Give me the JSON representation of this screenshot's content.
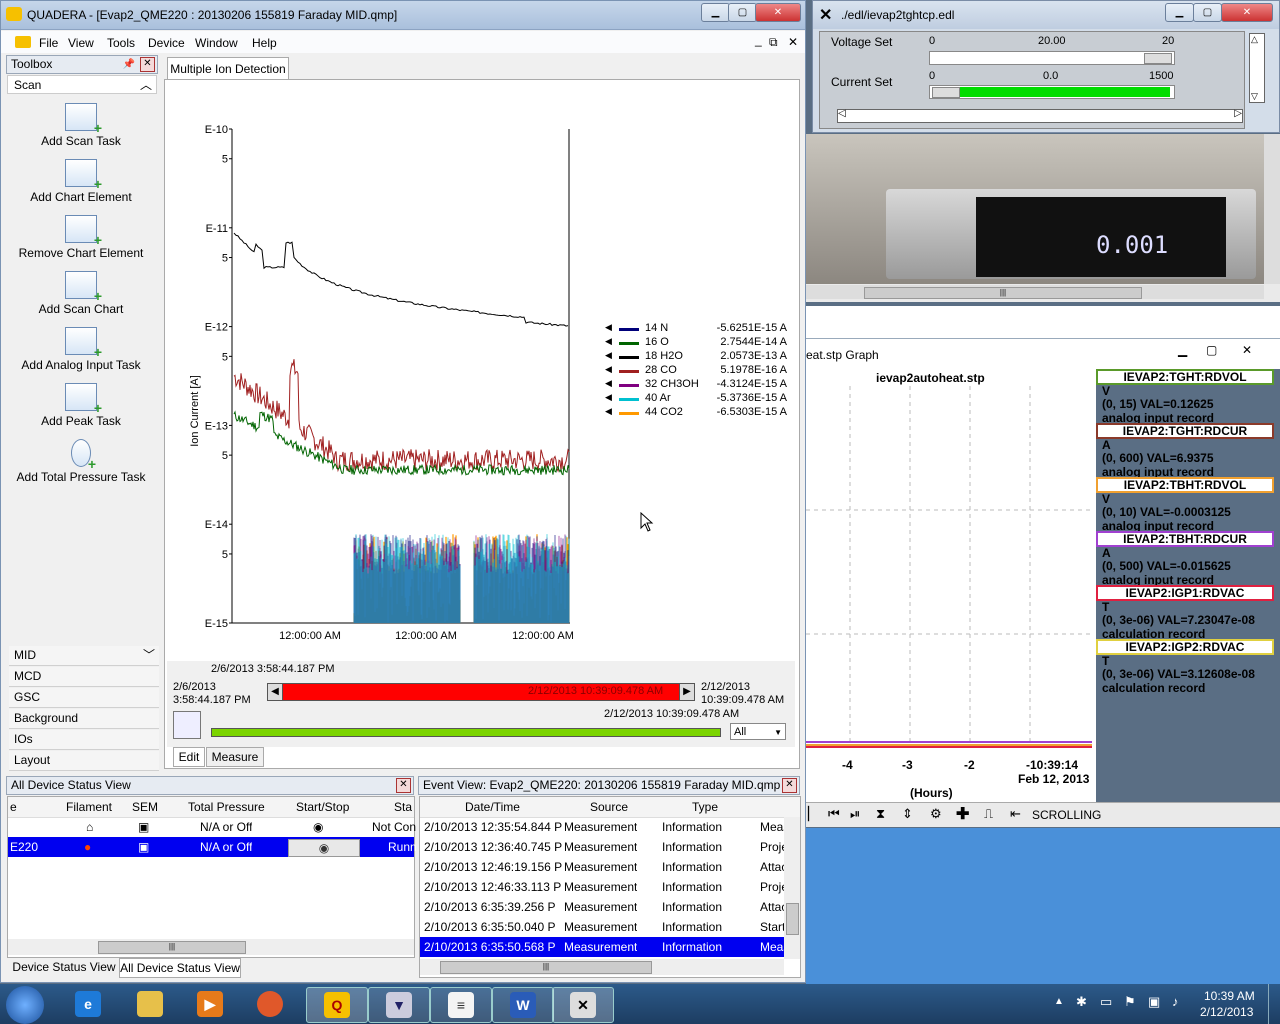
{
  "quadera": {
    "title": "QUADERA - [Evap2_QME220 : 20130206 155819 Faraday MID.qmp]",
    "menu": [
      "File",
      "View",
      "Tools",
      "Device",
      "Window",
      "Help"
    ],
    "toolbox_title": "Toolbox",
    "scan_header": "Scan",
    "tools": [
      "Add Scan Task",
      "Add Chart Element",
      "Remove Chart Element",
      "Add Scan Chart",
      "Add Analog Input Task",
      "Add Peak Task",
      "Add Total Pressure Task"
    ],
    "categories": [
      "MID",
      "MCD",
      "GSC",
      "Background",
      "IOs",
      "Layout"
    ],
    "tab": "Multiple Ion Detection",
    "bottom_tabs": [
      "Edit",
      "Measure"
    ],
    "time_start_top": "2/6/2013 3:58:44.187 PM",
    "time_start": "2/6/2013",
    "time_start2": "3:58:44.187 PM",
    "time_end": "2/12/2013",
    "time_end2": "10:39:09.478 AM",
    "time_slider": "2/12/2013 10:39:09.478 AM",
    "time_current": "2/12/2013 10:39:09.478 AM",
    "filter": "All"
  },
  "chart_data": {
    "type": "line",
    "ylabel": "Ion Current [A]",
    "yscale": "log",
    "ylim": [
      1e-15,
      1e-10
    ],
    "yticks": [
      "E-10",
      "5",
      "E-11",
      "5",
      "E-12",
      "5",
      "E-13",
      "5",
      "E-14",
      "5",
      "E-15"
    ],
    "xticks": [
      "12:00:00 AM",
      "12:00:00 AM",
      "12:00:00 AM"
    ],
    "series": [
      {
        "name": "14 N",
        "value": "-5.6251E-15 A",
        "color": "#00007a"
      },
      {
        "name": "16 O",
        "value": "2.7544E-14 A",
        "color": "#006400"
      },
      {
        "name": "18 H2O",
        "value": "2.0573E-13 A",
        "color": "#000000"
      },
      {
        "name": "28 CO",
        "value": "5.1978E-16 A",
        "color": "#a02020"
      },
      {
        "name": "32 CH3OH",
        "value": "-4.3124E-15 A",
        "color": "#800080"
      },
      {
        "name": "40 Ar",
        "value": "-5.3736E-15 A",
        "color": "#00c0d0"
      },
      {
        "name": "44 CO2",
        "value": "-6.5303E-15 A",
        "color": "#ff9900"
      }
    ]
  },
  "status_view": {
    "title": "All Device Status View",
    "headers": [
      "e",
      "Filament",
      "SEM",
      "Total Pressure",
      "Start/Stop",
      "Sta"
    ],
    "rows": [
      {
        "name": "",
        "pressure": "N/A or Off",
        "state": "Not Con"
      },
      {
        "name": "E220",
        "pressure": "N/A or Off",
        "state": "Runn"
      }
    ],
    "tabs": [
      "Device Status View",
      "All Device Status View"
    ]
  },
  "event_view": {
    "title": "Event View: Evap2_QME220: 20130206 155819 Faraday MID.qmp",
    "headers": [
      "Date/Time",
      "Source",
      "Type"
    ],
    "rows": [
      {
        "date": "2/10/2013 12:35:54.844 P",
        "source": "Measurement",
        "type": "Information",
        "extra": "Meas"
      },
      {
        "date": "2/10/2013 12:36:40.745 P",
        "source": "Measurement",
        "type": "Information",
        "extra": "Proje"
      },
      {
        "date": "2/10/2013 12:46:19.156 P",
        "source": "Measurement",
        "type": "Information",
        "extra": "Attac"
      },
      {
        "date": "2/10/2013 12:46:33.113 P",
        "source": "Measurement",
        "type": "Information",
        "extra": "Proje"
      },
      {
        "date": "2/10/2013 6:35:39.256 P",
        "source": "Measurement",
        "type": "Information",
        "extra": "Attac"
      },
      {
        "date": "2/10/2013 6:35:50.040 P",
        "source": "Measurement",
        "type": "Information",
        "extra": "Start"
      },
      {
        "date": "2/10/2013 6:35:50.568 P",
        "source": "Measurement",
        "type": "Information",
        "extra": "Meas"
      }
    ]
  },
  "edl": {
    "title": "./edl/ievap2tghtcp.edl",
    "voltage_label": "Voltage Set",
    "voltage_min": "0",
    "voltage_val": "20.00",
    "voltage_max": "20",
    "current_label": "Current Set",
    "current_min": "0",
    "current_val": "0.0",
    "current_max": "1500",
    "current_fill": 1.0
  },
  "graph": {
    "title": "eat.stp Graph",
    "plot_title": "ievap2autoheat.stp",
    "xticks": [
      "-4",
      "-3",
      "-2",
      "-10:39:14"
    ],
    "date_label": "Feb 12, 2013",
    "xlabel": "(Hours)",
    "scroll_label": "SCROLLING",
    "records": [
      {
        "name": "IEVAP2:TGHT:RDVOL",
        "unit": "V",
        "range": "(0, 15) VAL=0.12625",
        "kind": "analog input record",
        "color": "#5a9a2a"
      },
      {
        "name": "IEVAP2:TGHT:RDCUR",
        "unit": "A",
        "range": "(0, 600) VAL=6.9375",
        "kind": "analog input record",
        "color": "#8b3a2a"
      },
      {
        "name": "IEVAP2:TBHT:RDVOL",
        "unit": "V",
        "range": "(0, 10) VAL=-0.0003125",
        "kind": "analog input record",
        "color": "#f0a030"
      },
      {
        "name": "IEVAP2:TBHT:RDCUR",
        "unit": "A",
        "range": "(0, 500) VAL=-0.015625",
        "kind": "analog input record",
        "color": "#a040d0"
      },
      {
        "name": "IEVAP2:IGP1:RDVAC",
        "unit": "T",
        "range": "(0, 3e-06) VAL=7.23047e-08",
        "kind": "calculation record",
        "color": "#e02040"
      },
      {
        "name": "IEVAP2:IGP2:RDVAC",
        "unit": "T",
        "range": "(0, 3e-06) VAL=3.12608e-08",
        "kind": "calculation record",
        "color": "#e0d040"
      }
    ]
  },
  "taskbar": {
    "time": "10:39 AM",
    "date": "2/12/2013"
  }
}
